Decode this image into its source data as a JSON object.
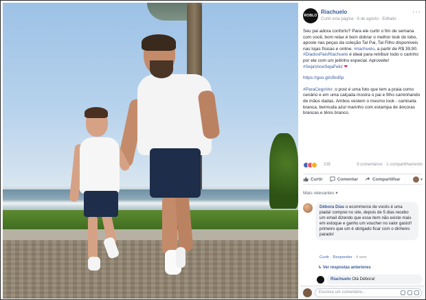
{
  "post": {
    "brand_avatar_text": "ROBLO",
    "author": "Riachuelo",
    "meta": "Curtir esta página · 6 de agosto · Editado",
    "body_p1_a": "Seu pai adora conforto? Para ele curtir o fim de semana com você, bom relax é bom dobrar o melhor look do lobo, aposte nas peças da coleção Tal Pai, Tal Filho disponíveis nas lojas físicas e online.",
    "body_p1_hash1": "#riachuelo",
    "body_p1_b": ", a partir de R$ 39,90.",
    "body_p1_hash2": "#DiadosPaisRiachuelo",
    "body_p1_c": " é ideal para retribuir todo o carinho por ele com um jeitinho especial. Aproveite!",
    "body_p1_hash3": "#SejaVoceSejaFeliz",
    "heart": "❤",
    "link": "https://goo.gl/cBrd5p",
    "body_p2_hash": "#ParaCegoVer",
    "body_p2": ": o post é uma foto que tem a praia como cenário e em uma calçada mostra o pai e filho caminhando de mãos dadas. Ambos vestem o mesmo look - camiseta branca, bermuda azul marinho com estampa de âncoras brancas e tênis branco."
  },
  "reactions": {
    "count": "235",
    "comments_shares": "9 comentários · 1 compartilhamento",
    "colors": {
      "like": "#4267b2",
      "love": "#f25268",
      "wow": "#f7b125"
    }
  },
  "actions": {
    "like": "Curtir",
    "comment": "Comentar",
    "share": "Compartilhar",
    "dropdown": "▾"
  },
  "comments": {
    "sort_label": "Mais relevantes ▾",
    "first": {
      "author": "Débora Dias",
      "text": " o ecommerce de vocês é uma piada! comprei no site, depois de 5 dias recebo um email dizendo que esse item não existe mais em estoque e ganho um voucher no valor gasto!! primeiro que um é obrigado ficar com o dinheiro parado!",
      "meta_like": "Curtir",
      "meta_reply": "Responder",
      "meta_time": "· 4 sem"
    },
    "replies_link": "↳ Ver respostas anteriores",
    "reply": {
      "author": "Riachuelo",
      "text": " Olá Débora!"
    },
    "compose_placeholder": "Escreva um comentário..."
  }
}
